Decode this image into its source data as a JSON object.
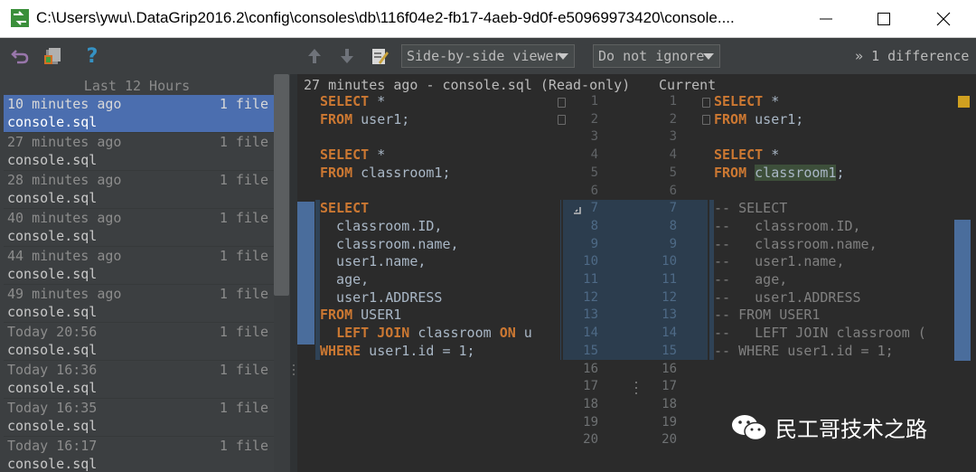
{
  "window": {
    "title": "C:\\Users\\ywu\\.DataGrip2016.2\\config\\consoles\\db\\116f04e2-fb17-4aeb-9d0f-e50969973420\\console...."
  },
  "toolbar": {
    "viewer_mode": "Side-by-side viewer",
    "whitespace_mode": "Do not ignore",
    "difference_count": "1 difference",
    "expand_glyph": "»"
  },
  "history": {
    "header": "Last 12 Hours",
    "items": [
      {
        "time": "10 minutes ago",
        "count": "1 file",
        "file": "console.sql",
        "selected": true
      },
      {
        "time": "27 minutes ago",
        "count": "1 file",
        "file": "console.sql"
      },
      {
        "time": "28 minutes ago",
        "count": "1 file",
        "file": "console.sql"
      },
      {
        "time": "40 minutes ago",
        "count": "1 file",
        "file": "console.sql"
      },
      {
        "time": "44 minutes ago",
        "count": "1 file",
        "file": "console.sql"
      },
      {
        "time": "49 minutes ago",
        "count": "1 file",
        "file": "console.sql"
      },
      {
        "time": "Today 20:56",
        "count": "1 file",
        "file": "console.sql"
      },
      {
        "time": "Today 16:36",
        "count": "1 file",
        "file": "console.sql"
      },
      {
        "time": "Today 16:35",
        "count": "1 file",
        "file": "console.sql"
      },
      {
        "time": "Today 16:17",
        "count": "1 file",
        "file": "console.sql"
      }
    ]
  },
  "diff": {
    "left_header": "27 minutes ago - console.sql (Read-only)",
    "right_header": "Current",
    "left_lines": [
      [
        [
          "kw",
          "SELECT"
        ],
        [
          "t",
          " *"
        ]
      ],
      [
        [
          "kw",
          "FROM"
        ],
        [
          "t",
          " user1;"
        ]
      ],
      [],
      [
        [
          "kw",
          "SELECT"
        ],
        [
          "t",
          " *"
        ]
      ],
      [
        [
          "kw",
          "FROM"
        ],
        [
          "t",
          " classroom1;"
        ]
      ],
      [],
      [
        [
          "kw",
          "SELECT"
        ]
      ],
      [
        [
          "t",
          "  classroom.ID,"
        ]
      ],
      [
        [
          "t",
          "  classroom.name,"
        ]
      ],
      [
        [
          "t",
          "  user1.name,"
        ]
      ],
      [
        [
          "t",
          "  age,"
        ]
      ],
      [
        [
          "t",
          "  user1.ADDRESS"
        ]
      ],
      [
        [
          "kw",
          "FROM"
        ],
        [
          "t",
          " USER1"
        ]
      ],
      [
        [
          "t",
          "  "
        ],
        [
          "kw",
          "LEFT JOIN"
        ],
        [
          "t",
          " classroom "
        ],
        [
          "kw",
          "ON"
        ],
        [
          "t",
          " u"
        ]
      ],
      [
        [
          "kw",
          "WHERE"
        ],
        [
          "t",
          " user1.id = 1;"
        ]
      ]
    ],
    "right_lines": [
      [
        [
          "kw",
          "SELECT"
        ],
        [
          "t",
          " *"
        ]
      ],
      [
        [
          "kw",
          "FROM"
        ],
        [
          "t",
          " user1;"
        ]
      ],
      [],
      [
        [
          "kw",
          "SELECT"
        ],
        [
          "t",
          " *"
        ]
      ],
      [
        [
          "kw",
          "FROM"
        ],
        [
          "t",
          " "
        ],
        [
          "hl",
          "classroom1"
        ],
        [
          "t",
          ";"
        ]
      ],
      [],
      [
        [
          "cm",
          "-- SELECT"
        ]
      ],
      [
        [
          "cm",
          "--   classroom.ID,"
        ]
      ],
      [
        [
          "cm",
          "--   classroom.name,"
        ]
      ],
      [
        [
          "cm",
          "--   user1.name,"
        ]
      ],
      [
        [
          "cm",
          "--   age,"
        ]
      ],
      [
        [
          "cm",
          "--   user1.ADDRESS"
        ]
      ],
      [
        [
          "cm",
          "-- FROM USER1"
        ]
      ],
      [
        [
          "cm",
          "--   LEFT JOIN classroom ("
        ]
      ],
      [
        [
          "cm",
          "-- WHERE user1.id = 1;"
        ]
      ]
    ],
    "line_numbers_left": [
      "1",
      "2",
      "3",
      "4",
      "5",
      "6",
      "7",
      "8",
      "9",
      "10",
      "11",
      "12",
      "13",
      "14",
      "15",
      "16",
      "17",
      "18",
      "19",
      "20"
    ],
    "line_numbers_right": [
      "1",
      "2",
      "3",
      "4",
      "5",
      "6",
      "7",
      "8",
      "9",
      "10",
      "11",
      "12",
      "13",
      "14",
      "15",
      "16",
      "17",
      "18",
      "19",
      "20"
    ]
  },
  "watermark": {
    "text": "民工哥技术之路"
  },
  "colors": {
    "keyword": "#cc7832",
    "comment": "#808080",
    "changed_block": "#2f4256",
    "selection": "#4b6eaf"
  }
}
